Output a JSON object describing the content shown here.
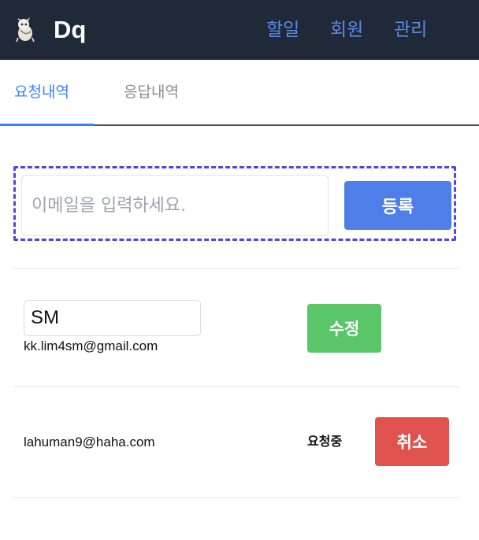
{
  "header": {
    "brand": "Dq",
    "nav": [
      "할일",
      "회원",
      "관리"
    ]
  },
  "tabs": {
    "active": "요청내역",
    "inactive": "응답내역"
  },
  "form": {
    "email_placeholder": "이메일을 입력하세요.",
    "register_label": "등록"
  },
  "list": [
    {
      "name_value": "SM",
      "email": "kk.lim4sm@gmail.com",
      "action_label": "수정"
    },
    {
      "email": "lahuman9@haha.com",
      "status": "요청중",
      "action_label": "취소"
    }
  ],
  "colors": {
    "header_bg": "#1f2937",
    "accent": "#3b82f6",
    "nav_text": "#5b8ae8",
    "register": "#4f7ee8",
    "edit": "#5ac569",
    "cancel": "#e0524e",
    "form_border": "#4f46e5"
  }
}
